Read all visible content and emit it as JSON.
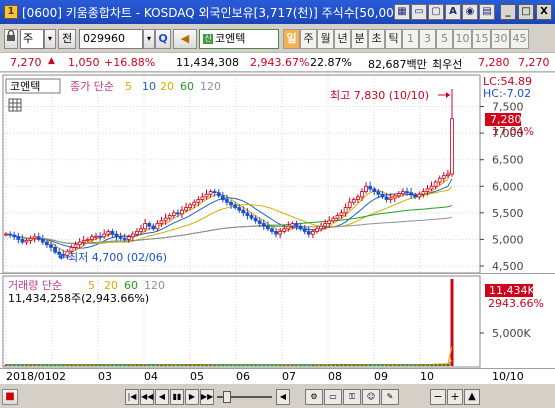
{
  "window": {
    "title": "[0600] 키움종합차트 - KOSDAQ 외국인보유[3,717(천)] 주식수[50,00",
    "app_icon": "1",
    "toolbar_icons": [
      "grid-icon",
      "window-icon",
      "tile-icon",
      "alert-icon",
      "camera-icon",
      "page-icon"
    ],
    "toolbar_glyphs": [
      "▦",
      "▭",
      "▢",
      "A",
      "◉",
      "▤"
    ],
    "minimize": "_",
    "maximize": "□",
    "close": "X"
  },
  "toolbar": {
    "chart_type": "주",
    "chart_type_arrow": "▾",
    "prev_label": "전",
    "stock_code": "029960",
    "search_glyph": "Q",
    "speaker_glyph": "◀",
    "market_badge": "신",
    "stock_name": "코엔텍",
    "periods": [
      {
        "label": "일",
        "active": true
      },
      {
        "label": "주",
        "active": false
      },
      {
        "label": "월",
        "active": false
      },
      {
        "label": "년",
        "active": false
      },
      {
        "label": "분",
        "active": false
      },
      {
        "label": "초",
        "active": false
      },
      {
        "label": "틱",
        "active": false
      },
      {
        "label": "1",
        "active": false,
        "num": true
      },
      {
        "label": "3",
        "active": false,
        "num": true
      },
      {
        "label": "5",
        "active": false,
        "num": true
      },
      {
        "label": "10",
        "active": false,
        "num": true
      },
      {
        "label": "15",
        "active": false,
        "num": true
      },
      {
        "label": "30",
        "active": false,
        "num": true
      },
      {
        "label": "45",
        "active": false,
        "num": true
      }
    ]
  },
  "quote": {
    "price": "7,270",
    "up_arrow": "▲",
    "change": "1,050",
    "change_pct": "+16.88%",
    "volume": "11,434,308",
    "vol_ratio": "2,943.67%",
    "turnover": "22.87%",
    "amount": "82,687백만",
    "best_ask_label": "최우선",
    "ask": "7,280",
    "bid": "7,270"
  },
  "price_panel": {
    "name_tag": "코엔텍",
    "ma_label": "종가 단순",
    "ma_periods": [
      "5",
      "10",
      "20",
      "60",
      "120"
    ],
    "ma_colors": [
      "#f0a000",
      "#1e5fd0",
      "#d0b000",
      "#20a020",
      "#909090"
    ],
    "lc": "LC:54.89",
    "hc": "HC:-7.02",
    "current_price_tag": "7,280",
    "current_pct_tag": "17.04%",
    "high_label": "최고 7,830 (10/10)",
    "low_label": "최저 4,700 (02/06)",
    "y_ticks": [
      "7,500",
      "7,000",
      "6,500",
      "6,000",
      "5,500",
      "5,000",
      "4,500"
    ]
  },
  "volume_panel": {
    "label": "거래량 단순",
    "ma_periods": [
      "5",
      "20",
      "60",
      "120"
    ],
    "ma_colors": [
      "#f0a000",
      "#d0b000",
      "#20a020",
      "#909090"
    ],
    "value": "11,434,258주(2,943.66%)",
    "current_tag": "11,434K",
    "pct_tag": "2943.66%",
    "y_tick": "5,000K"
  },
  "x_axis": {
    "labels": [
      "2018/01",
      "02",
      "03",
      "04",
      "05",
      "06",
      "07",
      "08",
      "09",
      "10"
    ],
    "last_date": "10/10"
  },
  "colors": {
    "up": "#d0021b",
    "down": "#1a4fd0",
    "tag_bg": "#d0021b",
    "titlebar": "#2a5cd8"
  },
  "chart_data": {
    "type": "candlestick",
    "y_axis_range": [
      4500,
      7830
    ],
    "y_tick_values": [
      7500,
      7000,
      6500,
      6000,
      5500,
      5000,
      4500
    ],
    "volume_y_tick_value": 5000,
    "months": [
      "2018/01",
      "02",
      "03",
      "04",
      "05",
      "06",
      "07",
      "08",
      "09",
      "10"
    ],
    "close_series_approx": [
      5100,
      5080,
      5050,
      5000,
      4950,
      4980,
      5020,
      5050,
      5000,
      4950,
      4900,
      4850,
      4760,
      4720,
      4700,
      4780,
      4850,
      4900,
      4950,
      4980,
      5000,
      5050,
      5060,
      5050,
      5100,
      5150,
      5100,
      5050,
      5020,
      5000,
      5050,
      5100,
      5150,
      5200,
      5300,
      5250,
      5200,
      5300,
      5350,
      5400,
      5450,
      5500,
      5480,
      5550,
      5600,
      5650,
      5700,
      5750,
      5800,
      5850,
      5900,
      5880,
      5820,
      5750,
      5700,
      5650,
      5600,
      5550,
      5500,
      5450,
      5400,
      5350,
      5300,
      5250,
      5200,
      5150,
      5100,
      5150,
      5200,
      5250,
      5300,
      5250,
      5200,
      5150,
      5100,
      5150,
      5200,
      5250,
      5300,
      5350,
      5400,
      5450,
      5500,
      5600,
      5700,
      5750,
      5800,
      5900,
      6000,
      5950,
      5900,
      5850,
      5800,
      5750,
      5780,
      5820,
      5860,
      5900,
      5880,
      5840,
      5800,
      5850,
      5900,
      5950,
      6000,
      6080,
      6150,
      6200,
      6230,
      7270
    ],
    "volume_series_approx": [
      180,
      160,
      150,
      200,
      170,
      140,
      130,
      150,
      160,
      140,
      130,
      120,
      180,
      160,
      150,
      140,
      130,
      140,
      150,
      160,
      200,
      220,
      180,
      170,
      160,
      150,
      140,
      150,
      160,
      170,
      180,
      200,
      190,
      160,
      150,
      140,
      160,
      170,
      180,
      150,
      140,
      130,
      150,
      160,
      220,
      240,
      180,
      160,
      150,
      140,
      130,
      120,
      150,
      160,
      170,
      140,
      130,
      150,
      160,
      140,
      130,
      120,
      130,
      140,
      150,
      160,
      150,
      140,
      130,
      150,
      160,
      170,
      150,
      140,
      130,
      120,
      140,
      160,
      180,
      200,
      220,
      180,
      160,
      240,
      200,
      180,
      160,
      150,
      180,
      170,
      160,
      150,
      140,
      130,
      150,
      160,
      170,
      150,
      140,
      130,
      150,
      170,
      180,
      200,
      250,
      280,
      300,
      320,
      350,
      11434
    ],
    "volume_unit": "천주",
    "grid": true
  }
}
